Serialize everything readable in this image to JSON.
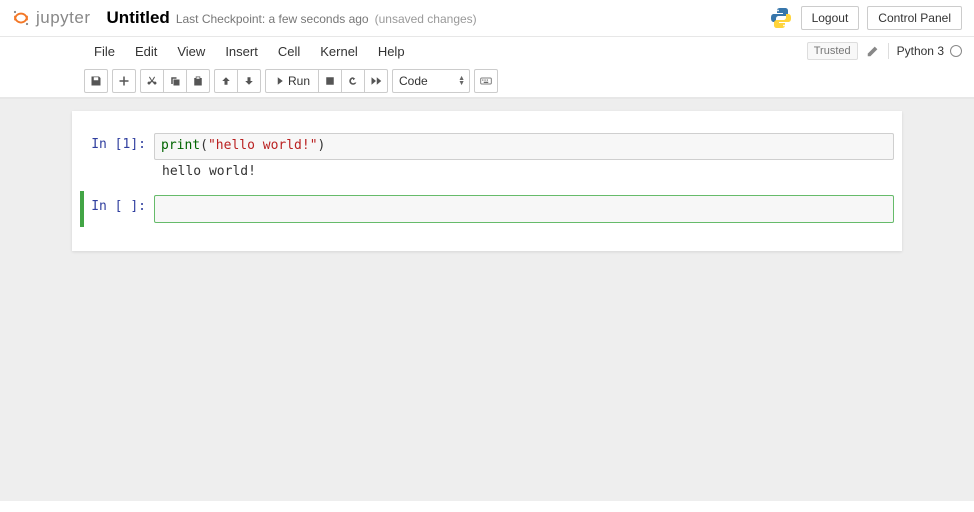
{
  "header": {
    "logo_text": "jupyter",
    "title": "Untitled",
    "checkpoint": "Last Checkpoint: a few seconds ago",
    "unsaved": "(unsaved changes)",
    "logout": "Logout",
    "control_panel": "Control Panel"
  },
  "menubar": {
    "items": [
      "File",
      "Edit",
      "View",
      "Insert",
      "Cell",
      "Kernel",
      "Help"
    ],
    "trusted": "Trusted",
    "kernel": "Python 3"
  },
  "toolbar": {
    "run_label": "Run",
    "celltype": "Code"
  },
  "cells": [
    {
      "prompt": "In [1]:",
      "code_fn": "print",
      "code_open": "(",
      "code_str": "\"hello world!\"",
      "code_close": ")",
      "output": "hello world!"
    },
    {
      "prompt": "In [ ]:"
    }
  ]
}
